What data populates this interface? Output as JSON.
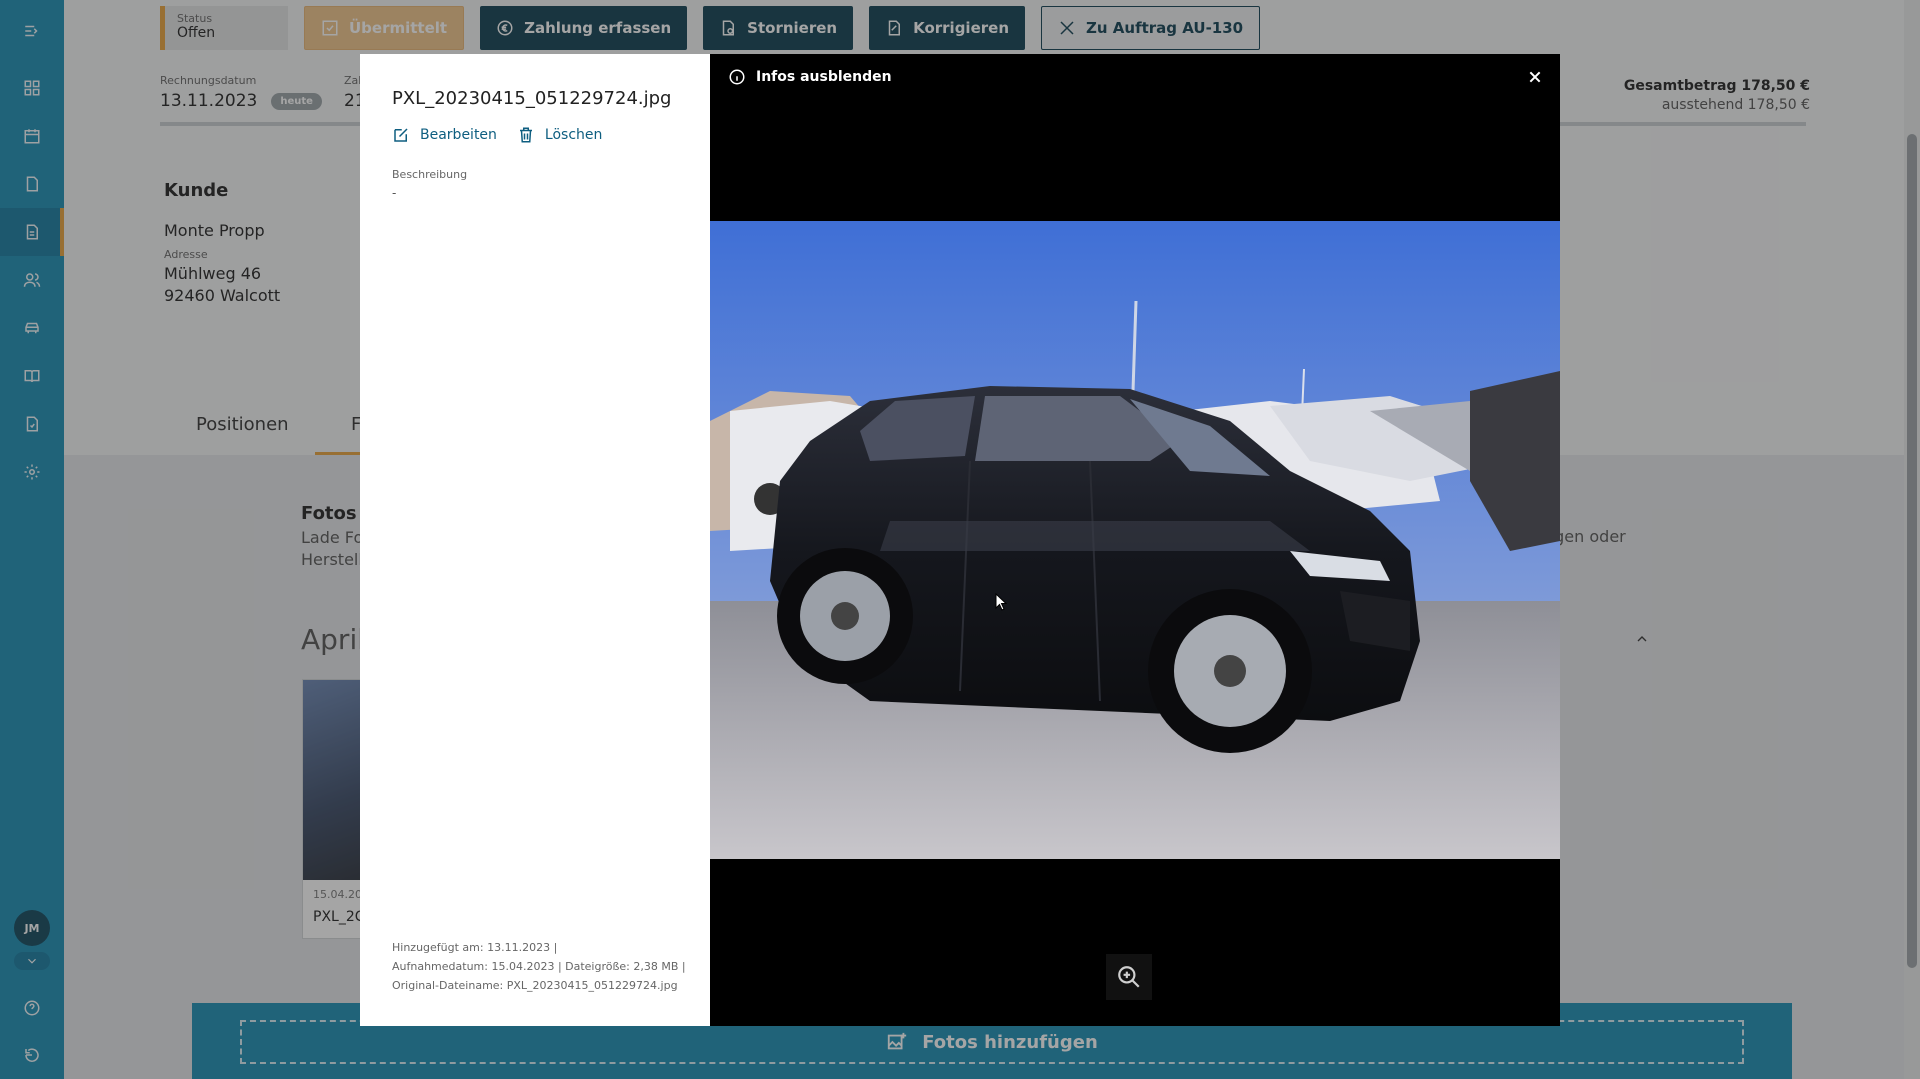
{
  "toolbar": {
    "status_label": "Status",
    "status_value": "Offen",
    "submitted_label": "Übermittelt",
    "payment_label": "Zahlung erfassen",
    "cancel_label": "Stornieren",
    "correct_label": "Korrigieren",
    "order_label": "Zu Auftrag AU-130"
  },
  "invoice": {
    "date_label": "Rechnungsdatum",
    "date_value": "13.11.2023",
    "today_badge": "heute",
    "due_label_partial": "Zah",
    "due_value_partial": "21",
    "total_label": "Gesamtbetrag 178,50 €",
    "outstanding_label": "ausstehend 178,50 €"
  },
  "customer": {
    "heading": "Kunde",
    "name": "Monte Propp",
    "address_label": "Adresse",
    "street": "Mühlweg 46",
    "city": "92460 Walcott"
  },
  "tabs": {
    "positions": "Positionen",
    "photos_partial": "F"
  },
  "photos": {
    "title_partial": "Fotos z",
    "desc_line1_partial": "Lade Fot",
    "desc_line2_partial": "Herstelle",
    "desc_right_partial": "ngen oder",
    "month_partial": "April",
    "card_date_partial": "15.04.20",
    "card_name_partial": "PXL_2C",
    "add_button": "Fotos hinzufügen"
  },
  "user": {
    "initials": "JM"
  },
  "modal": {
    "file_name": "PXL_20230415_051229724.jpg",
    "edit_label": "Bearbeiten",
    "delete_label": "Löschen",
    "description_label": "Beschreibung",
    "description_value": "-",
    "meta_added": "Hinzugefügt am: 13.11.2023 |",
    "meta_taken": "Aufnahmedatum: 15.04.2023 | Dateigröße: 2,38 MB |",
    "meta_original": "Original-Dateiname: PXL_20230415_051229724.jpg",
    "toggle_info": "Infos ausblenden"
  },
  "colors": {
    "primary": "#1a8db4",
    "dark": "#0e3e51",
    "accent": "#e8a33b"
  }
}
